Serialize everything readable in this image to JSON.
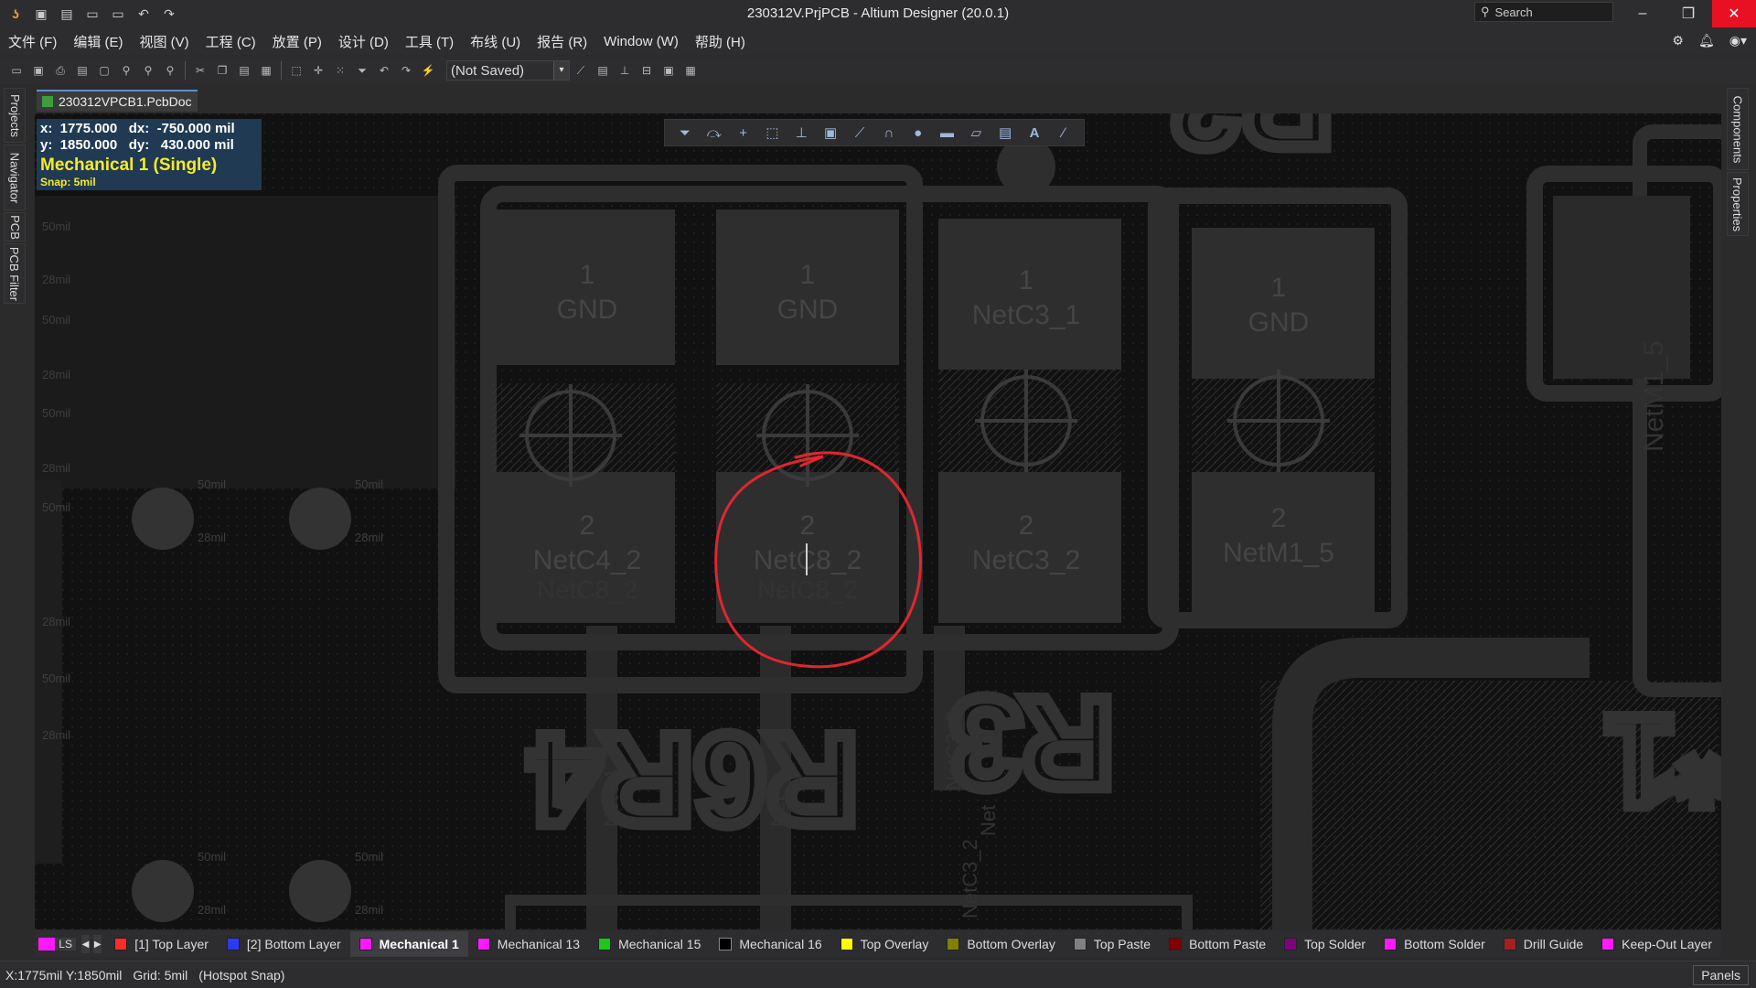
{
  "window": {
    "title": "230312V.PrjPCB - Altium Designer (20.0.1)",
    "search_placeholder": "Search"
  },
  "menu": [
    "文件 (F)",
    "编辑 (E)",
    "视图 (V)",
    "工程 (C)",
    "放置 (P)",
    "设计 (D)",
    "工具 (T)",
    "布线 (U)",
    "报告 (R)",
    "Window (W)",
    "帮助 (H)"
  ],
  "toolbar": {
    "variant_value": "(Not Saved)"
  },
  "left_tabs": [
    "Projects",
    "Navigator",
    "PCB",
    "PCB Filter"
  ],
  "right_tabs": [
    "Components",
    "Properties"
  ],
  "document_tab": "230312VPCB1.PcbDoc",
  "hud": {
    "x_line": "x:  1775.000   dx:  -750.000 mil",
    "y_line": "y:  1850.000   dy:   430.000 mil",
    "layer": "Mechanical 1 (Single)",
    "snap": "Snap: 5mil"
  },
  "pads": [
    {
      "num": "1",
      "net": "GND"
    },
    {
      "num": "1",
      "net": "GND"
    },
    {
      "num": "1",
      "net": "NetC3_1"
    },
    {
      "num": "1",
      "net": "GND"
    },
    {
      "num": "2",
      "net": "NetC4_2"
    },
    {
      "num": "2",
      "net": "NetC8_2"
    },
    {
      "num": "2",
      "net": "NetC3_2"
    },
    {
      "num": "2",
      "net": "NetM1_5"
    }
  ],
  "ghost_nets": [
    "NetC8_2",
    "NetC8_2"
  ],
  "designators": [
    "R4",
    "R6",
    "R3",
    "R2",
    "*1"
  ],
  "vias": [
    {
      "size": "50mil",
      "hole": "28mil"
    },
    {
      "size": "50mil",
      "hole": "28mil"
    },
    {
      "size": "50mil",
      "hole": "28mil"
    },
    {
      "size": "50mil",
      "hole": "28mil"
    }
  ],
  "edge_labels": [
    "50mil",
    "28mil",
    "50mil",
    "28mil",
    "50mil",
    "28mil",
    "50mil",
    "28mil",
    "50mil",
    "28mil"
  ],
  "rotated_nets": [
    "NetC4_2",
    "Net",
    "NetC3_2",
    "NetC3_2",
    "Net",
    "NetM1_5"
  ],
  "layers": {
    "ls": "LS",
    "items": [
      {
        "label": "[1] Top Layer",
        "color": "#ff2a2a"
      },
      {
        "label": "[2] Bottom Layer",
        "color": "#2a3bff"
      },
      {
        "label": "Mechanical 1",
        "color": "#ff19ff",
        "active": true
      },
      {
        "label": "Mechanical 13",
        "color": "#ff19ff"
      },
      {
        "label": "Mechanical 15",
        "color": "#19c819"
      },
      {
        "label": "Mechanical 16",
        "color": "#000000"
      },
      {
        "label": "Top Overlay",
        "color": "#ffff00"
      },
      {
        "label": "Bottom Overlay",
        "color": "#808000"
      },
      {
        "label": "Top Paste",
        "color": "#808080"
      },
      {
        "label": "Bottom Paste",
        "color": "#800000"
      },
      {
        "label": "Top Solder",
        "color": "#800080"
      },
      {
        "label": "Bottom Solder",
        "color": "#ff19ff"
      },
      {
        "label": "Drill Guide",
        "color": "#a52020"
      },
      {
        "label": "Keep-Out Layer",
        "color": "#ff19ff"
      }
    ]
  },
  "status": {
    "coords": "X:1775mil Y:1850mil",
    "grid": "Grid: 5mil",
    "snap": "(Hotspot Snap)",
    "panels": "Panels"
  },
  "colors": {
    "annotation": "#e0262e",
    "board_bg": "#111111",
    "component_gray": "#2e2e2e"
  }
}
